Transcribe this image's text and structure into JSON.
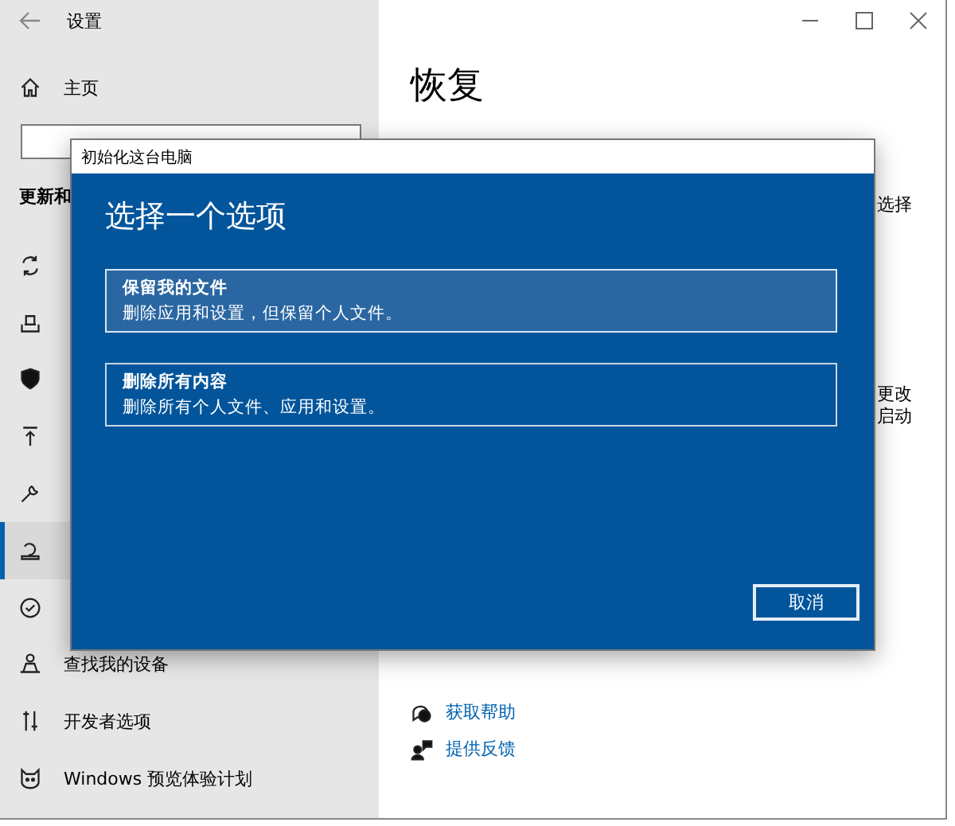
{
  "window": {
    "title": "设置"
  },
  "sidebar": {
    "home": "主页",
    "section": "更新和",
    "items": [
      {
        "kind": "sync",
        "selected": false
      },
      {
        "kind": "delivery",
        "selected": false
      },
      {
        "kind": "shield",
        "selected": false
      },
      {
        "kind": "backup",
        "selected": false
      },
      {
        "kind": "wrench",
        "selected": false
      },
      {
        "kind": "recovery",
        "selected": true
      },
      {
        "kind": "activation",
        "selected": false
      },
      {
        "kind": "person",
        "label": "查找我的设备",
        "selected": false
      },
      {
        "kind": "tools",
        "label": "开发者选项",
        "selected": false
      },
      {
        "kind": "cat",
        "label": "Windows 预览体验计划",
        "selected": false
      }
    ]
  },
  "main": {
    "title": "恢复",
    "fragments": [
      {
        "text": "选择"
      },
      {
        "text": "更改"
      },
      {
        "text": "启动"
      }
    ],
    "links": [
      {
        "kind": "help",
        "label": "获取帮助"
      },
      {
        "kind": "feedback",
        "label": "提供反馈"
      }
    ]
  },
  "dialog": {
    "title": "初始化这台电脑",
    "heading": "选择一个选项",
    "options": [
      {
        "title": "保留我的文件",
        "description": "删除应用和设置，但保留个人文件。",
        "selected": true
      },
      {
        "title": "删除所有内容",
        "description": "删除所有个人文件、应用和设置。",
        "selected": false
      }
    ],
    "cancel": "取消"
  }
}
